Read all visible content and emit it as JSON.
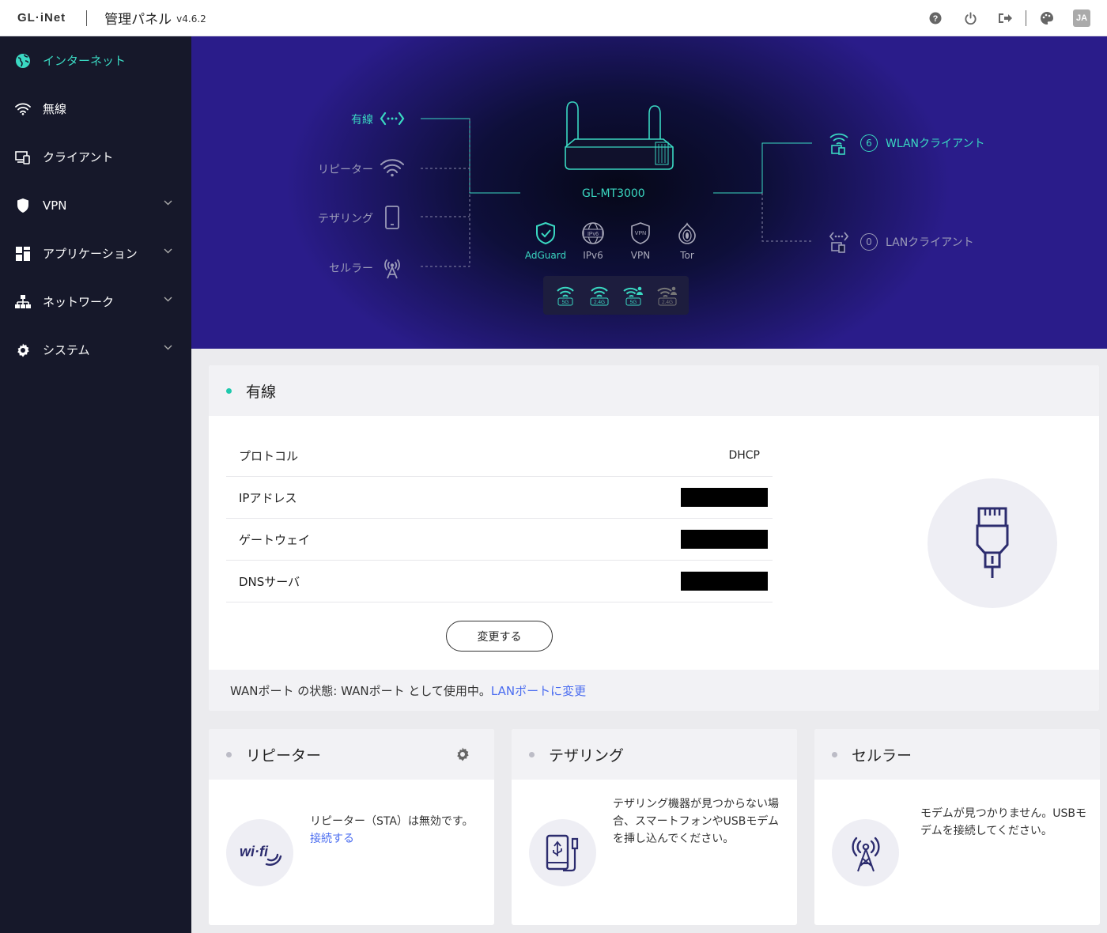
{
  "topbar": {
    "logo": "GL·iNet",
    "title": "管理パネル",
    "version": "v4.6.2",
    "lang": "JA",
    "icons": [
      "help-icon",
      "power-icon",
      "logout-icon",
      "theme-icon"
    ]
  },
  "sidebar": {
    "items": [
      {
        "label": "インターネット",
        "icon": "globe-icon",
        "active": true
      },
      {
        "label": "無線",
        "icon": "wifi-icon"
      },
      {
        "label": "クライアント",
        "icon": "devices-icon"
      },
      {
        "label": "VPN",
        "icon": "shield-icon",
        "expandable": true
      },
      {
        "label": "アプリケーション",
        "icon": "apps-icon",
        "expandable": true
      },
      {
        "label": "ネットワーク",
        "icon": "network-icon",
        "expandable": true
      },
      {
        "label": "システム",
        "icon": "gear-icon",
        "expandable": true
      }
    ]
  },
  "hero": {
    "sources": [
      {
        "label": "有線",
        "active": true
      },
      {
        "label": "リピーター"
      },
      {
        "label": "テザリング"
      },
      {
        "label": "セルラー"
      }
    ],
    "device_name": "GL-MT3000",
    "services": [
      {
        "label": "AdGuard",
        "active": true
      },
      {
        "label": "IPv6"
      },
      {
        "label": "VPN"
      },
      {
        "label": "Tor"
      }
    ],
    "wifi_bands": [
      "5G",
      "2.4G",
      "5G",
      "2.4G"
    ],
    "wlan_clients": {
      "count": "6",
      "label": "WLANクライアント"
    },
    "lan_clients": {
      "count": "0",
      "label": "LANクライアント"
    },
    "colors": {
      "accent": "#3ad8c2",
      "inactive": "#9a9ab8"
    }
  },
  "wired": {
    "title": "有線",
    "rows": [
      {
        "key": "プロトコル",
        "value": "DHCP"
      },
      {
        "key": "IPアドレス",
        "value": null,
        "redacted": true
      },
      {
        "key": "ゲートウェイ",
        "value": null,
        "redacted": true
      },
      {
        "key": "DNSサーバ",
        "value": null,
        "redacted": true
      }
    ],
    "change_button": "変更する",
    "footer_status": "WANポート の状態:  WANポート として使用中。",
    "footer_link": "LANポートに変更"
  },
  "repeater": {
    "title": "リピーター",
    "text": "リピーター（STA）は無効です。",
    "link": "接続する"
  },
  "tethering": {
    "title": "テザリング",
    "text": "テザリング機器が見つからない場合、スマートフォンやUSBモデムを挿し込んでください。"
  },
  "cellular": {
    "title": "セルラー",
    "text": "モデムが見つかりません。USBモデムを接続してください。"
  }
}
